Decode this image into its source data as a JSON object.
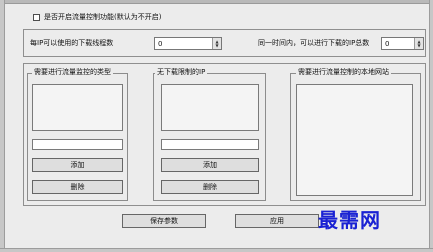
{
  "enable_option": {
    "label": "是否开启流量控制功能(默认为不开启)",
    "checked": false
  },
  "thread_setting": {
    "label": "每IP可以使用的下载线程数",
    "value": "0"
  },
  "concurrent_setting": {
    "label": "同一时间内，可以进行下载的IP总数",
    "value": "0"
  },
  "groups": {
    "types": {
      "title": "需要进行流量监控的类型",
      "add_label": "添加",
      "delete_label": "删除"
    },
    "unlimited_ips": {
      "title": "无下载限制的IP",
      "add_label": "添加",
      "delete_label": "删除"
    },
    "local_sites": {
      "title": "需要进行流量控制的本地网站"
    }
  },
  "actions": {
    "save_label": "保存参数",
    "apply_label": "应用"
  },
  "watermark": {
    "text": "最需网"
  }
}
